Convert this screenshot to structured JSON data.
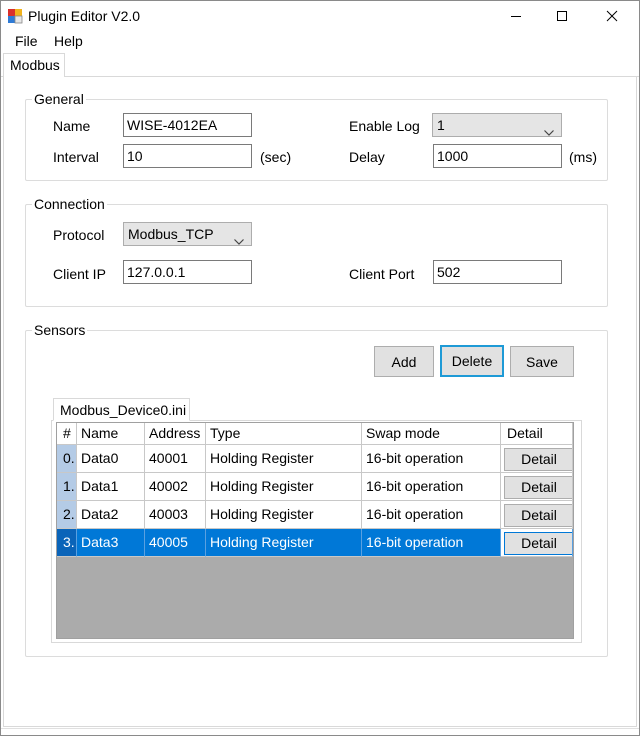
{
  "window": {
    "title": "Plugin Editor V2.0",
    "icons": [
      "app-icon",
      "minimize-icon",
      "maximize-icon",
      "close-icon"
    ]
  },
  "menu": {
    "file": "File",
    "help": "Help"
  },
  "tabs": {
    "modbus": "Modbus"
  },
  "general": {
    "title": "General",
    "name_label": "Name",
    "name_value": "WISE-4012EA",
    "interval_label": "Interval",
    "interval_value": "10",
    "interval_unit": "(sec)",
    "enable_log_label": "Enable Log",
    "enable_log_value": "1",
    "delay_label": "Delay",
    "delay_value": "1000",
    "delay_unit": "(ms)"
  },
  "connection": {
    "title": "Connection",
    "protocol_label": "Protocol",
    "protocol_value": "Modbus_TCP",
    "client_ip_label": "Client IP",
    "client_ip_value": "127.0.0.1",
    "client_port_label": "Client Port",
    "client_port_value": "502"
  },
  "sensors": {
    "title": "Sensors",
    "add": "Add",
    "delete": "Delete",
    "save": "Save",
    "device_tab": "Modbus_Device0.ini",
    "columns": [
      "#",
      "Name",
      "Address",
      "Type",
      "Swap mode",
      "Detail"
    ],
    "rows": [
      {
        "idx": "0.",
        "name": "Data0",
        "address": "40001",
        "type": "Holding Register",
        "swap": "16-bit operation",
        "detail": "Detail",
        "selected": false
      },
      {
        "idx": "1.",
        "name": "Data1",
        "address": "40002",
        "type": "Holding Register",
        "swap": "16-bit operation",
        "detail": "Detail",
        "selected": false
      },
      {
        "idx": "2.",
        "name": "Data2",
        "address": "40003",
        "type": "Holding Register",
        "swap": "16-bit operation",
        "detail": "Detail",
        "selected": false
      },
      {
        "idx": "3.",
        "name": "Data3",
        "address": "40005",
        "type": "Holding Register",
        "swap": "16-bit operation",
        "detail": "Detail",
        "selected": true
      }
    ]
  },
  "colors": {
    "selection": "#0078d7",
    "focus_border": "#1e9ad6",
    "grid_background": "#ababab"
  }
}
